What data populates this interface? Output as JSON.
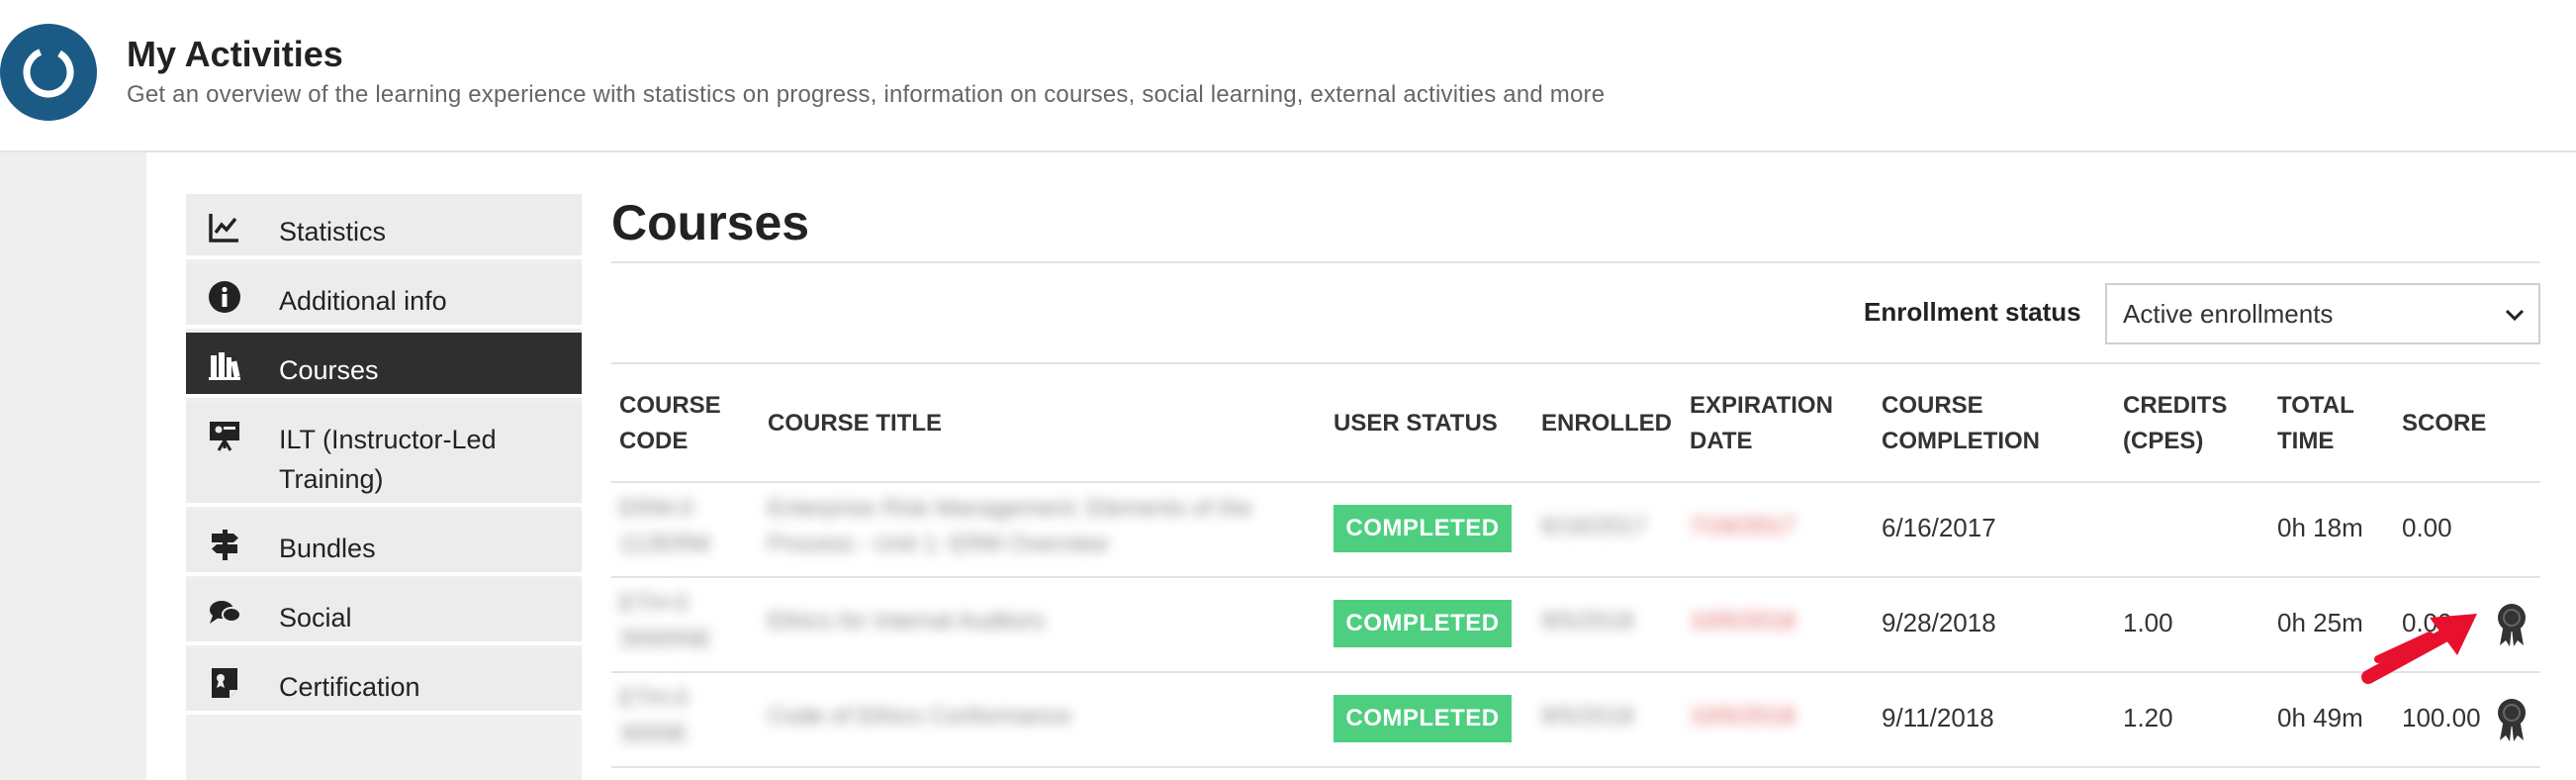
{
  "header": {
    "title": "My Activities",
    "subtitle": "Get an overview of the learning experience with statistics on progress, information on courses, social learning, external activities and more"
  },
  "sidebar": {
    "items": [
      {
        "label": "Statistics",
        "icon": "chart-line-icon"
      },
      {
        "label": "Additional info",
        "icon": "info-icon"
      },
      {
        "label": "Courses",
        "icon": "books-icon",
        "active": true
      },
      {
        "label": "ILT (Instructor-Led Training)",
        "icon": "presentation-icon"
      },
      {
        "label": "Bundles",
        "icon": "signpost-icon"
      },
      {
        "label": "Social",
        "icon": "chat-bubbles-icon"
      },
      {
        "label": "Certification",
        "icon": "certificate-icon"
      }
    ]
  },
  "main": {
    "title": "Courses",
    "filter": {
      "label": "Enrollment status",
      "value": "Active enrollments"
    },
    "table": {
      "headers": {
        "code": [
          "COURSE",
          "CODE"
        ],
        "title": "COURSE TITLE",
        "user_status": "USER STATUS",
        "enrolled": "ENROLLED",
        "expiration": [
          "EXPIRATION",
          "DATE"
        ],
        "completion": [
          "COURSE",
          "COMPLETION"
        ],
        "credits": [
          "CREDITS",
          "(CPES)"
        ],
        "total_time": [
          "TOTAL",
          "TIME"
        ],
        "score": "SCORE"
      },
      "rows": [
        {
          "code": [
            "ERM-0",
            "112ERM"
          ],
          "title": [
            "Enterprise Risk Management: Elements of the",
            "Process - Unit 1: ERM Overview"
          ],
          "status": "COMPLETED",
          "enrolled": "6/16/2017",
          "expiration": "7/16/2017",
          "completion": "6/16/2017",
          "credits": "",
          "total_time": "0h 18m",
          "score": "0.00",
          "certificate": false
        },
        {
          "code": [
            "ETH-0",
            "3000INE"
          ],
          "title": [
            "Ethics for Internal Auditors"
          ],
          "status": "COMPLETED",
          "enrolled": "9/5/2018",
          "expiration": "10/5/2018",
          "completion": "9/28/2018",
          "credits": "1.00",
          "total_time": "0h 25m",
          "score": "0.00",
          "certificate": true
        },
        {
          "code": [
            "ETH-0",
            "3000E"
          ],
          "title": [
            "Code of Ethics Conformance"
          ],
          "status": "COMPLETED",
          "enrolled": "9/5/2018",
          "expiration": "10/5/2018",
          "completion": "9/11/2018",
          "credits": "1.20",
          "total_time": "0h 49m",
          "score": "100.00",
          "certificate": true
        }
      ]
    }
  },
  "colors": {
    "brand": "#1c5a86",
    "completed_badge": "#4dcf7f",
    "sidebar_active": "#2f2f2f",
    "annotation_arrow": "#e8112d"
  }
}
